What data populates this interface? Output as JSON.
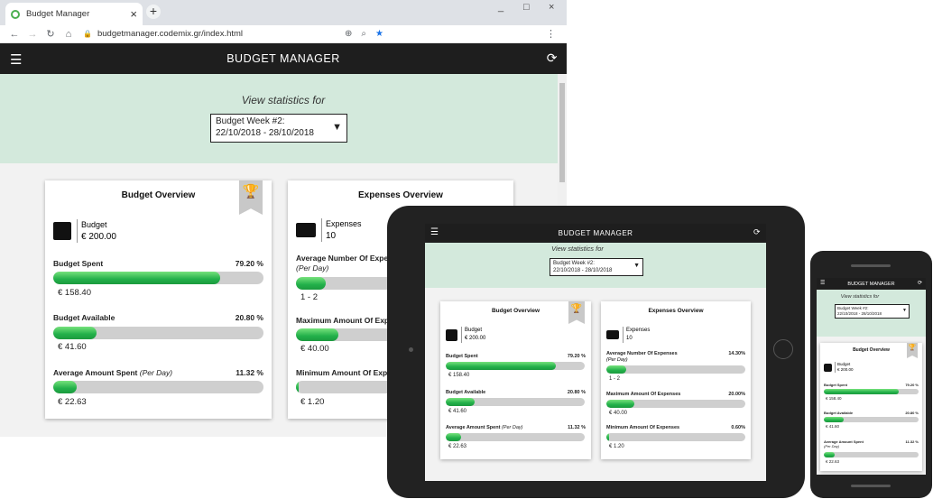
{
  "browser": {
    "tab_title": "Budget Manager",
    "tab_close": "×",
    "new_tab": "+",
    "url": "budgetmanager.codemix.gr/index.html",
    "window_controls": [
      "_",
      "□",
      "×"
    ]
  },
  "app": {
    "title": "BUDGET MANAGER",
    "icons": {
      "menu": "menu-icon",
      "refresh": "refresh-icon"
    }
  },
  "stats": {
    "label": "View statistics for",
    "selected_week_line1": "Budget Week #2:",
    "selected_week_line2": "22/10/2018 - 28/10/2018"
  },
  "budget_overview": {
    "title": "Budget Overview",
    "summary_label": "Budget",
    "summary_value": "€ 200.00",
    "metrics": [
      {
        "label": "Budget Spent",
        "label_suffix": "",
        "percent_text": "79.20 %",
        "percent": 79.2,
        "value": "€ 158.40"
      },
      {
        "label": "Budget Available",
        "label_suffix": "",
        "percent_text": "20.80 %",
        "percent": 20.8,
        "value": "€ 41.60"
      },
      {
        "label": "Average Amount Spent",
        "label_suffix": "(Per Day)",
        "percent_text": "11.32 %",
        "percent": 11.32,
        "value": "€ 22.63"
      }
    ]
  },
  "expenses_overview": {
    "title": "Expenses Overview",
    "summary_label": "Expenses",
    "summary_value": "10",
    "metrics": [
      {
        "label": "Average Number Of Expenses",
        "label_suffix": "(Per Day)",
        "percent_text": "14.30%",
        "percent": 14.3,
        "value": "1 - 2"
      },
      {
        "label": "Maximum Amount Of Expenses",
        "label_suffix": "",
        "percent_text": "20.00%",
        "percent": 20.0,
        "value": "€ 40.00"
      },
      {
        "label": "Minimum Amount Of Expenses",
        "label_suffix": "",
        "percent_text": "0.60%",
        "percent": 0.6,
        "value": "€ 1.20"
      }
    ]
  },
  "browser_truncated": {
    "exp_m1": "Average Number Of Expe",
    "exp_m2": "Maximum Amount Of Exp",
    "exp_m3": "Minimum Amount Of Expe"
  },
  "colors": {
    "accent_green": "#22b04a",
    "app_bar": "#1e1e1e",
    "stats_band": "#d3e9dc",
    "trophy": "#f5c400"
  }
}
